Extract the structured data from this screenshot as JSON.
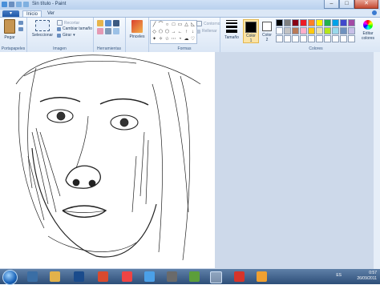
{
  "window": {
    "title": "Sin título - Paint"
  },
  "tabs": {
    "file_label": "▾",
    "home": "Inicio",
    "view": "Ver"
  },
  "clipboard": {
    "paste": "Pegar",
    "group": "Portapapeles"
  },
  "image": {
    "select": "Seleccionar",
    "crop": "Recortar",
    "resize": "Cambiar tamaño",
    "rotate": "Girar",
    "group": "Imagen"
  },
  "tools": {
    "group": "Herramientas"
  },
  "brushes": {
    "label": "Pinceles"
  },
  "shapes": {
    "outline": "Contorno",
    "fill": "Rellenar",
    "group": "Formas",
    "items": [
      "╱",
      "⌒",
      "○",
      "□",
      "▭",
      "△",
      "◺",
      "◇",
      "⬠",
      "⬡",
      "→",
      "←",
      "↑",
      "↓",
      "✦",
      "✧",
      "☆",
      "⋯",
      "◔",
      "☁",
      "♡"
    ]
  },
  "size": {
    "label": "Tamaño"
  },
  "color1": {
    "label": "Color",
    "num": "1",
    "value": "#000000"
  },
  "color2": {
    "label": "Color",
    "num": "2",
    "value": "#ffffff"
  },
  "colors": {
    "group": "Colores",
    "edit": "Editar colores",
    "palette": [
      "#000000",
      "#7f7f7f",
      "#880015",
      "#ed1c24",
      "#ff7f27",
      "#fff200",
      "#22b14c",
      "#00a2e8",
      "#3f48cc",
      "#a349a4",
      "#ffffff",
      "#c3c3c3",
      "#b97a57",
      "#ffaec9",
      "#ffc90e",
      "#efe4b0",
      "#b5e61d",
      "#99d9ea",
      "#7092be",
      "#c8bfe7",
      "#ffffff",
      "#ffffff",
      "#ffffff",
      "#ffffff",
      "#ffffff",
      "#ffffff",
      "#ffffff",
      "#ffffff",
      "#ffffff",
      "#ffffff"
    ]
  },
  "taskbar": {
    "lang": "ES",
    "time": "0:57",
    "date": "26/09/2011"
  }
}
